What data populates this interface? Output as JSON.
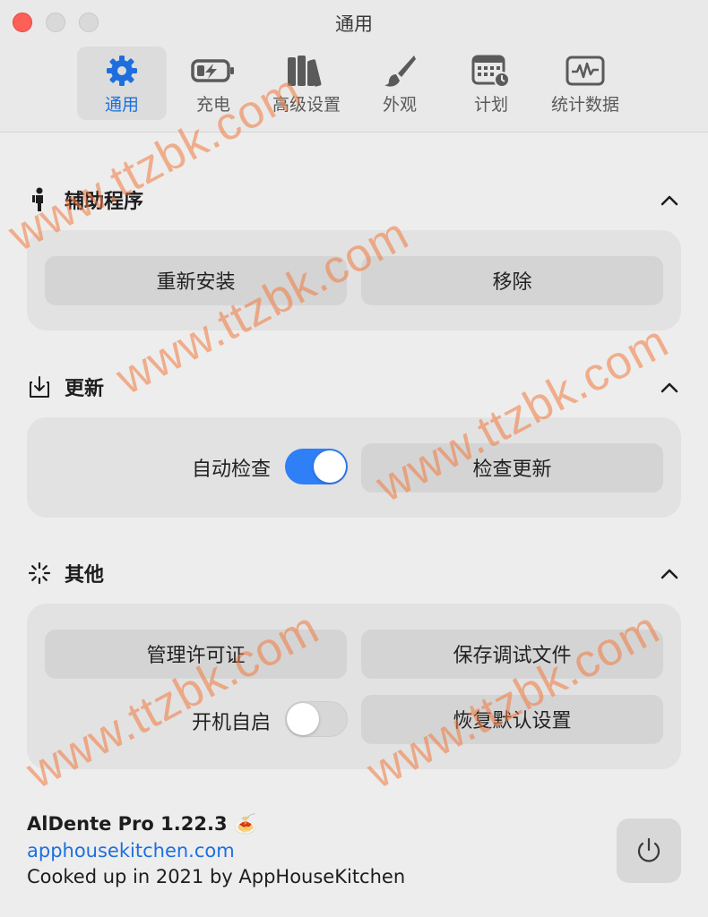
{
  "window": {
    "title": "通用"
  },
  "tabs": [
    {
      "label": "通用",
      "icon": "gear-icon",
      "active": true
    },
    {
      "label": "充电",
      "icon": "battery-charging-icon",
      "active": false
    },
    {
      "label": "高级设置",
      "icon": "books-icon",
      "active": false
    },
    {
      "label": "外观",
      "icon": "paintbrush-icon",
      "active": false
    },
    {
      "label": "计划",
      "icon": "calendar-clock-icon",
      "active": false
    },
    {
      "label": "统计数据",
      "icon": "chart-waveform-icon",
      "active": false
    }
  ],
  "sections": {
    "helper": {
      "title": "辅助程序",
      "icon": "person-icon",
      "reinstall_label": "重新安装",
      "remove_label": "移除"
    },
    "update": {
      "title": "更新",
      "icon": "download-tray-icon",
      "auto_check_label": "自动检查",
      "auto_check_on": true,
      "check_update_label": "检查更新"
    },
    "other": {
      "title": "其他",
      "icon": "spinner-icon",
      "manage_license_label": "管理许可证",
      "save_debug_label": "保存调试文件",
      "launch_at_login_label": "开机自启",
      "launch_at_login_on": false,
      "restore_defaults_label": "恢复默认设置"
    }
  },
  "footer": {
    "app_name": "AlDente Pro 1.22.3",
    "app_emoji": "🍝",
    "website": "apphousekitchen.com",
    "credit": "Cooked up in 2021 by AppHouseKitchen"
  },
  "watermark": "www.ttzbk.com",
  "colors": {
    "accent": "#1e6fdd",
    "toggle_on": "#2f7ff6",
    "close": "#fe5f57",
    "watermark": "#f0783c"
  }
}
